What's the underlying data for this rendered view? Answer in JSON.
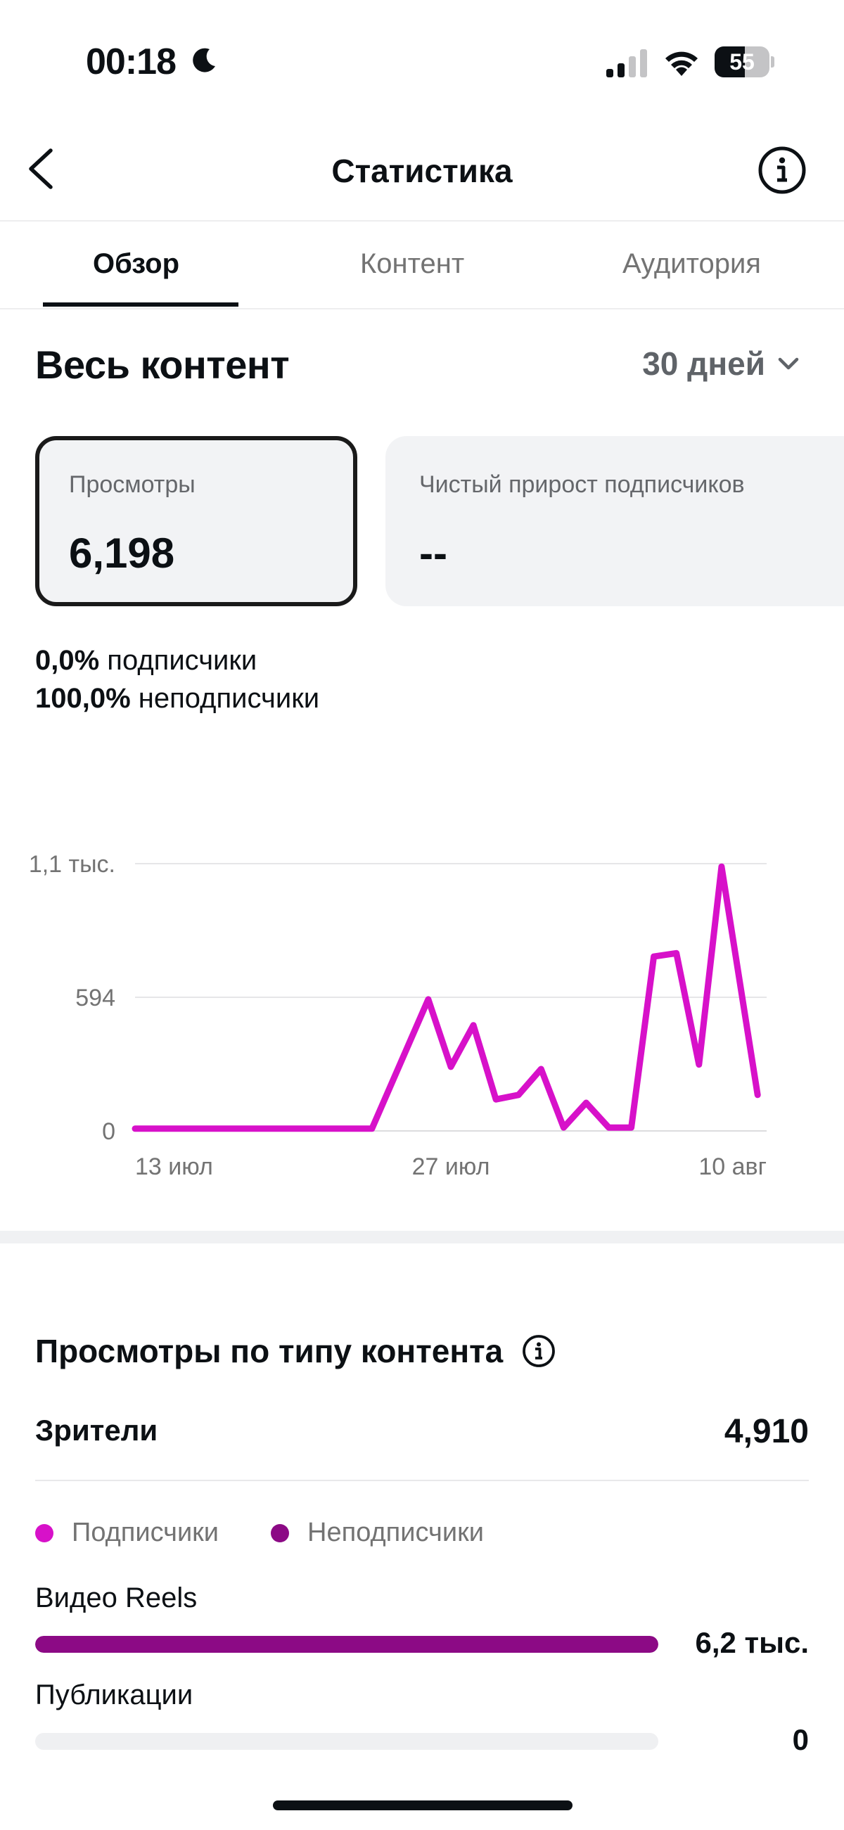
{
  "status_bar": {
    "time": "00:18",
    "battery_level": "55",
    "battery_fraction": 0.55
  },
  "header": {
    "title": "Статистика"
  },
  "tabs": [
    {
      "label": "Обзор",
      "active": true
    },
    {
      "label": "Контент",
      "active": false
    },
    {
      "label": "Аудитория",
      "active": false
    }
  ],
  "overview": {
    "section_title": "Весь контент",
    "period": "30 дней",
    "cards": [
      {
        "label": "Просмотры",
        "value": "6,198",
        "selected": true
      },
      {
        "label": "Чистый прирост подписчиков",
        "value": "--",
        "selected": false
      }
    ],
    "split": {
      "followers_pct": "0,0%",
      "followers_label": "подписчики",
      "non_followers_pct": "100,0%",
      "non_followers_label": "неподписчики"
    }
  },
  "chart_data": {
    "type": "line",
    "y_tick_labels": [
      "0",
      "594",
      "1,1 тыс."
    ],
    "y_ticks": [
      0,
      594,
      1188
    ],
    "ylim": [
      0,
      1188
    ],
    "x_tick_labels": [
      "13 июл",
      "27 июл",
      "10 авг"
    ],
    "x_tick_index": [
      0,
      14,
      28
    ],
    "grid": true,
    "line_color": "#d711c9",
    "series": [
      {
        "values": [
          10,
          10,
          10,
          10,
          10,
          10,
          10,
          10,
          10,
          10,
          10,
          585,
          285,
          470,
          140,
          160,
          275,
          15,
          125,
          15,
          15,
          775,
          790,
          295,
          1175,
          160
        ]
      }
    ],
    "x_index": [
      0,
      1,
      2,
      3,
      4,
      5,
      6,
      7,
      8,
      9,
      10.5,
      13,
      14,
      15,
      16,
      17,
      18,
      19,
      20,
      21,
      22,
      23,
      24,
      25,
      26,
      27.6
    ]
  },
  "content_type": {
    "title": "Просмотры по типу контента",
    "viewers_label": "Зрители",
    "viewers_value": "4,910",
    "legend": [
      {
        "label": "Подписчики",
        "color": "#d711c9"
      },
      {
        "label": "Неподписчики",
        "color": "#8c0a85"
      }
    ],
    "rows": [
      {
        "label": "Видео Reels",
        "value": "6,2 тыс.",
        "fraction": 1.0,
        "color": "#8c0a85"
      },
      {
        "label": "Публикации",
        "value": "0",
        "fraction": 0.0,
        "color": "#8c0a85"
      }
    ]
  },
  "colors": {
    "accent": "#d711c9",
    "accent_dark": "#8c0a85",
    "text": "#0c1014",
    "muted": "#737373"
  }
}
